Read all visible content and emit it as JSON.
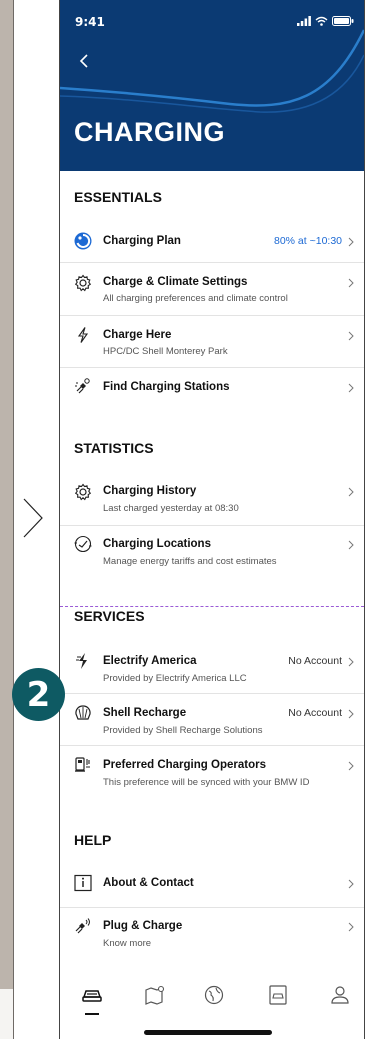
{
  "status": {
    "time": "9:41"
  },
  "header": {
    "title": "CHARGING"
  },
  "sections": {
    "essentials": "ESSENTIALS",
    "statistics": "STATISTICS",
    "services": "SERVICES",
    "help": "HELP"
  },
  "essentials": {
    "charging_plan": {
      "title": "Charging Plan",
      "value": "80% at ~10:30"
    },
    "charge_climate": {
      "title": "Charge & Climate Settings",
      "sub": "All charging preferences and climate control"
    },
    "charge_here": {
      "title": "Charge Here",
      "sub": "HPC/DC Shell Monterey Park"
    },
    "find_stations": {
      "title": "Find Charging Stations"
    }
  },
  "statistics": {
    "history": {
      "title": "Charging History",
      "sub": "Last charged yesterday at 08:30"
    },
    "locations": {
      "title": "Charging Locations",
      "sub": "Manage energy tariffs and cost estimates"
    }
  },
  "services": {
    "electrify": {
      "title": "Electrify America",
      "sub": "Provided by Electrify America LLC",
      "value": "No Account"
    },
    "shell": {
      "title": "Shell Recharge",
      "sub": "Provided by Shell Recharge Solutions",
      "value": "No Account"
    },
    "preferred": {
      "title": "Preferred Charging Operators",
      "sub": "This preference will be synced with your BMW ID"
    }
  },
  "help": {
    "about": {
      "title": "About & Contact"
    },
    "plug_charge": {
      "title": "Plug & Charge",
      "sub": "Know more"
    }
  },
  "callout": {
    "label": "2"
  },
  "colors": {
    "header_bg": "#0b3a73",
    "accent_blue": "#1c69d4",
    "callout_bg": "#0e5a63",
    "dashed_line": "#9a5bd6"
  },
  "tabs": [
    "car-icon",
    "map-icon",
    "globe-icon",
    "vehicle-profile-icon",
    "profile-icon"
  ]
}
